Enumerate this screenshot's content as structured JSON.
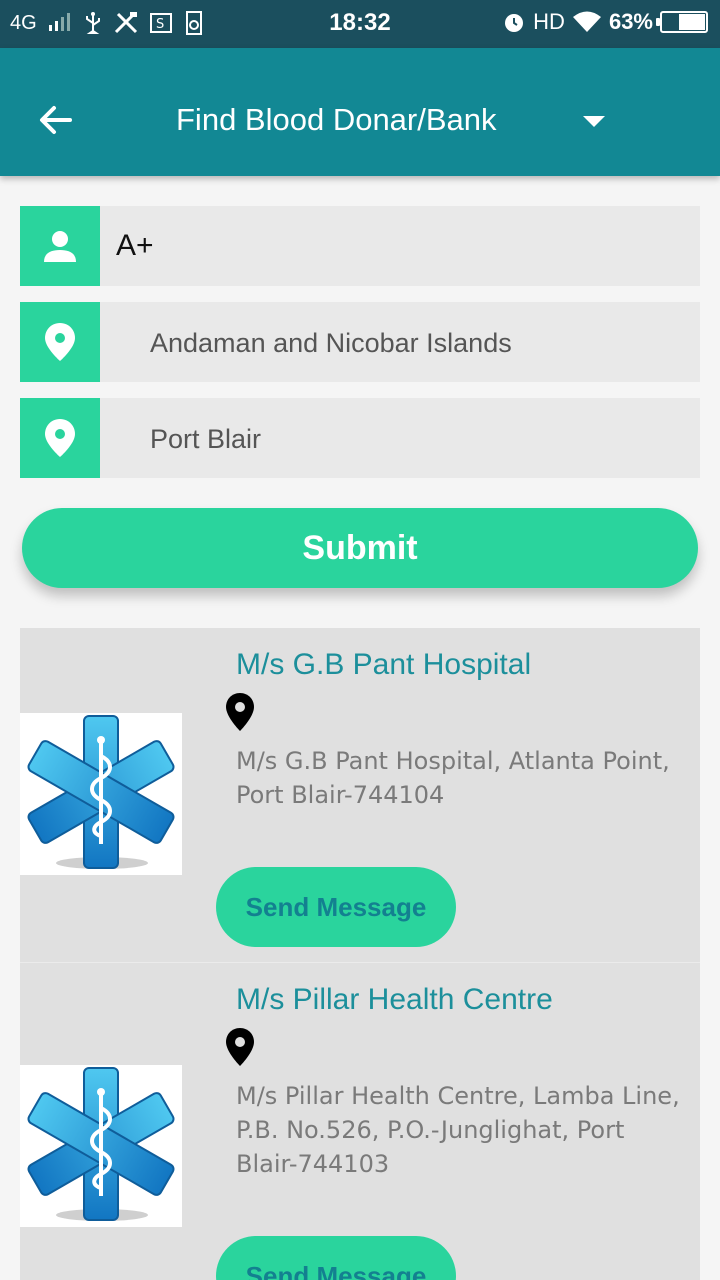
{
  "status_bar": {
    "network": "4G",
    "time": "18:32",
    "hd_label": "HD",
    "battery": "63%",
    "battery_level": 0.63
  },
  "app_bar": {
    "title": "Find Blood Donar/Bank"
  },
  "form": {
    "blood_group": "A+",
    "state": "Andaman and Nicobar Islands",
    "city": "Port Blair",
    "submit_label": "Submit"
  },
  "results": [
    {
      "name": "M/s G.B Pant Hospital",
      "address": "M/s G.B Pant Hospital, Atlanta Point, Port Blair-744104",
      "button_label": "Send Message"
    },
    {
      "name": "M/s Pillar Health Centre",
      "address": "M/s Pillar Health Centre, Lamba Line, P.B. No.526, P.O.-Junglighat, Port Blair-744103",
      "button_label": "Send Message"
    }
  ],
  "colors": {
    "status_bar": "#1b4f5e",
    "app_bar": "#128894",
    "accent": "#2ad49d",
    "result_title": "#1c8f9b",
    "card_bg": "#e0e0e0"
  },
  "icons": {
    "back": "arrow-left-icon",
    "dropdown": "caret-down-icon",
    "blood_group": "person-icon",
    "location": "map-pin-icon",
    "logo": "star-of-life-icon"
  }
}
